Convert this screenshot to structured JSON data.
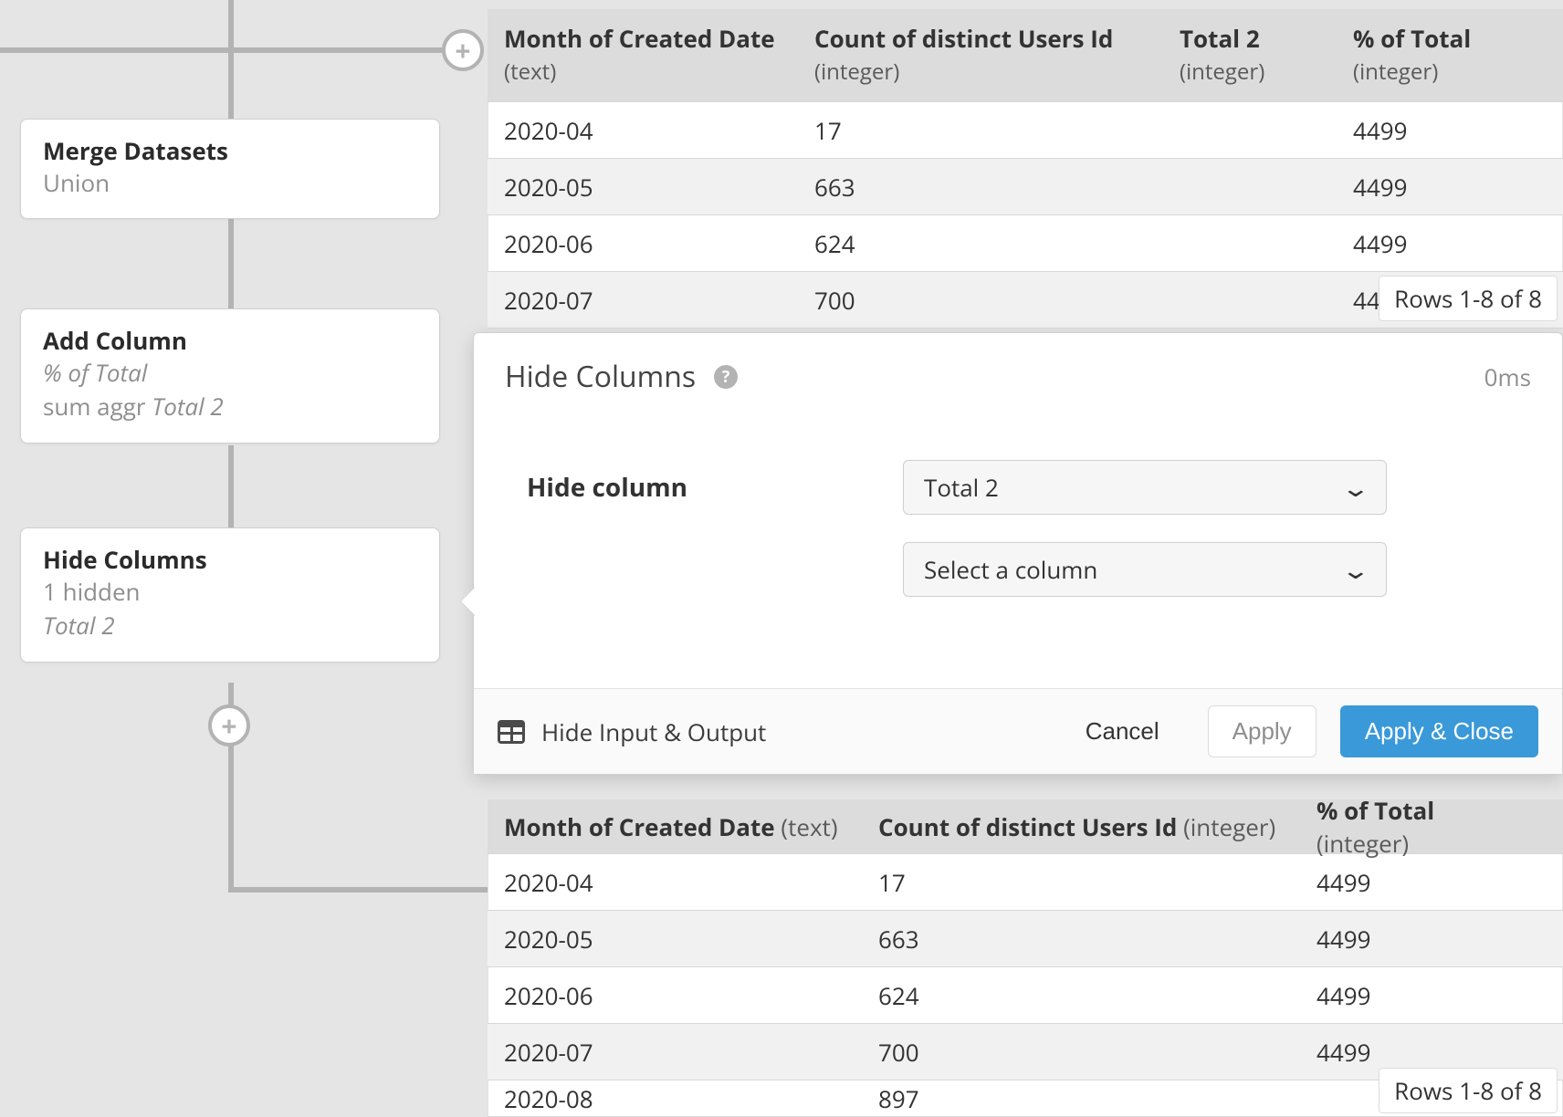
{
  "flow": {
    "node_merge": {
      "title": "Merge Datasets",
      "sub": "Union"
    },
    "node_add": {
      "title": "Add Column",
      "sub1": "% of Total",
      "sub2_prefix": "sum aggr ",
      "sub2_em": "Total 2"
    },
    "node_hide": {
      "title": "Hide Columns",
      "sub1": "1 hidden",
      "sub2_em": "Total 2"
    }
  },
  "table_top": {
    "cols": [
      {
        "name": "Month of Created Date",
        "type": "(text)"
      },
      {
        "name": "Count of distinct Users Id",
        "type": "(integer)"
      },
      {
        "name": "Total 2",
        "type": "(integer)"
      },
      {
        "name": "% of Total",
        "type": "(integer)"
      }
    ],
    "rows": [
      {
        "c0": "2020-04",
        "c1": "17",
        "c2": "",
        "c3": "4499"
      },
      {
        "c0": "2020-05",
        "c1": "663",
        "c2": "",
        "c3": "4499"
      },
      {
        "c0": "2020-06",
        "c1": "624",
        "c2": "",
        "c3": "4499"
      },
      {
        "c0": "2020-07",
        "c1": "700",
        "c2": "",
        "c3": "4499"
      }
    ],
    "rows_badge": "Rows 1-8 of 8"
  },
  "panel": {
    "title": "Hide Columns",
    "timing": "0ms",
    "field_label": "Hide column",
    "select1": "Total 2",
    "select2": "Select a column",
    "hide_io": "Hide Input & Output",
    "cancel": "Cancel",
    "apply": "Apply",
    "apply_close": "Apply & Close"
  },
  "table_bottom": {
    "cols": [
      {
        "name": "Month of Created Date",
        "type": "(text)"
      },
      {
        "name": "Count of distinct Users Id",
        "type": "(integer)"
      },
      {
        "name": "% of Total",
        "type": "(integer)"
      }
    ],
    "rows": [
      {
        "c0": "2020-04",
        "c1": "17",
        "c2": "4499"
      },
      {
        "c0": "2020-05",
        "c1": "663",
        "c2": "4499"
      },
      {
        "c0": "2020-06",
        "c1": "624",
        "c2": "4499"
      },
      {
        "c0": "2020-07",
        "c1": "700",
        "c2": "4499"
      },
      {
        "c0": "2020-08",
        "c1": "897",
        "c2": ""
      }
    ],
    "rows_badge": "Rows 1-8 of 8"
  }
}
